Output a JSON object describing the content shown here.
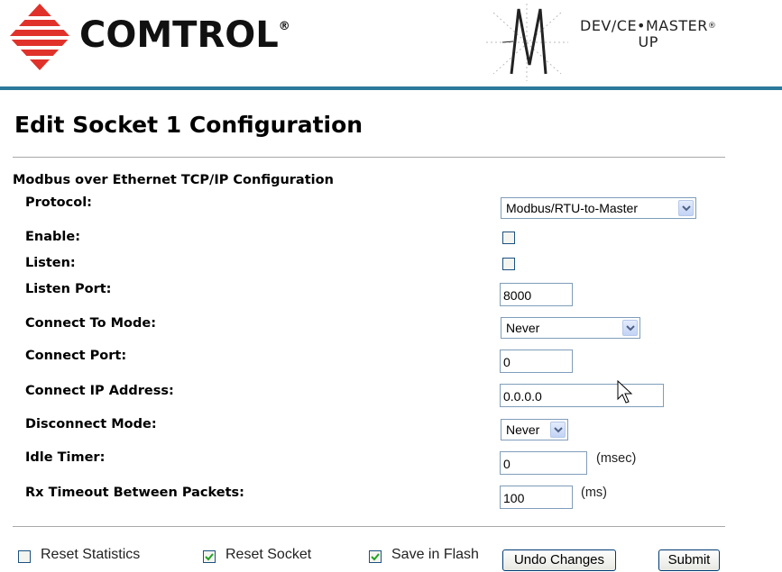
{
  "header": {
    "brand": "Comtrol",
    "brand_display": "COMTROL",
    "brand_reg": "®",
    "product_line1": "DEV/CE•MASTER",
    "product_reg": "®",
    "product_line2": "UP"
  },
  "page_title": "Edit Socket 1 Configuration",
  "section_title": "Modbus over Ethernet TCP/IP Configuration",
  "fields": {
    "protocol": {
      "label": "Protocol:",
      "value": "Modbus/RTU-to-Master"
    },
    "enable": {
      "label": "Enable:",
      "checked": false
    },
    "listen": {
      "label": "Listen:",
      "checked": false
    },
    "listen_port": {
      "label": "Listen Port:",
      "value": "8000"
    },
    "connect_to_mode": {
      "label": "Connect To Mode:",
      "value": "Never"
    },
    "connect_port": {
      "label": "Connect Port:",
      "value": "0"
    },
    "connect_ip": {
      "label": "Connect IP Address:",
      "value": "0.0.0.0"
    },
    "disconnect_mode": {
      "label": "Disconnect Mode:",
      "value": "Never"
    },
    "idle_timer": {
      "label": "Idle Timer:",
      "value": "0",
      "unit": "(msec)"
    },
    "rx_timeout": {
      "label": "Rx Timeout Between Packets:",
      "value": "100",
      "unit": "(ms)"
    }
  },
  "footer": {
    "reset_statistics": {
      "label": "Reset Statistics",
      "checked": false
    },
    "reset_socket": {
      "label": "Reset Socket",
      "checked": true
    },
    "save_in_flash": {
      "label": "Save in Flash",
      "checked": true
    },
    "undo_button": "Undo Changes",
    "submit_button": "Submit"
  },
  "colors": {
    "header_rule": "#2b7a9b",
    "logo_red": "#e0322b",
    "input_border": "#7f9db9"
  },
  "icons": [
    "comtrol-logo-icon",
    "devicemaster-logo-icon",
    "dropdown-arrow-icon",
    "checkmark-icon",
    "mouse-cursor-icon"
  ]
}
